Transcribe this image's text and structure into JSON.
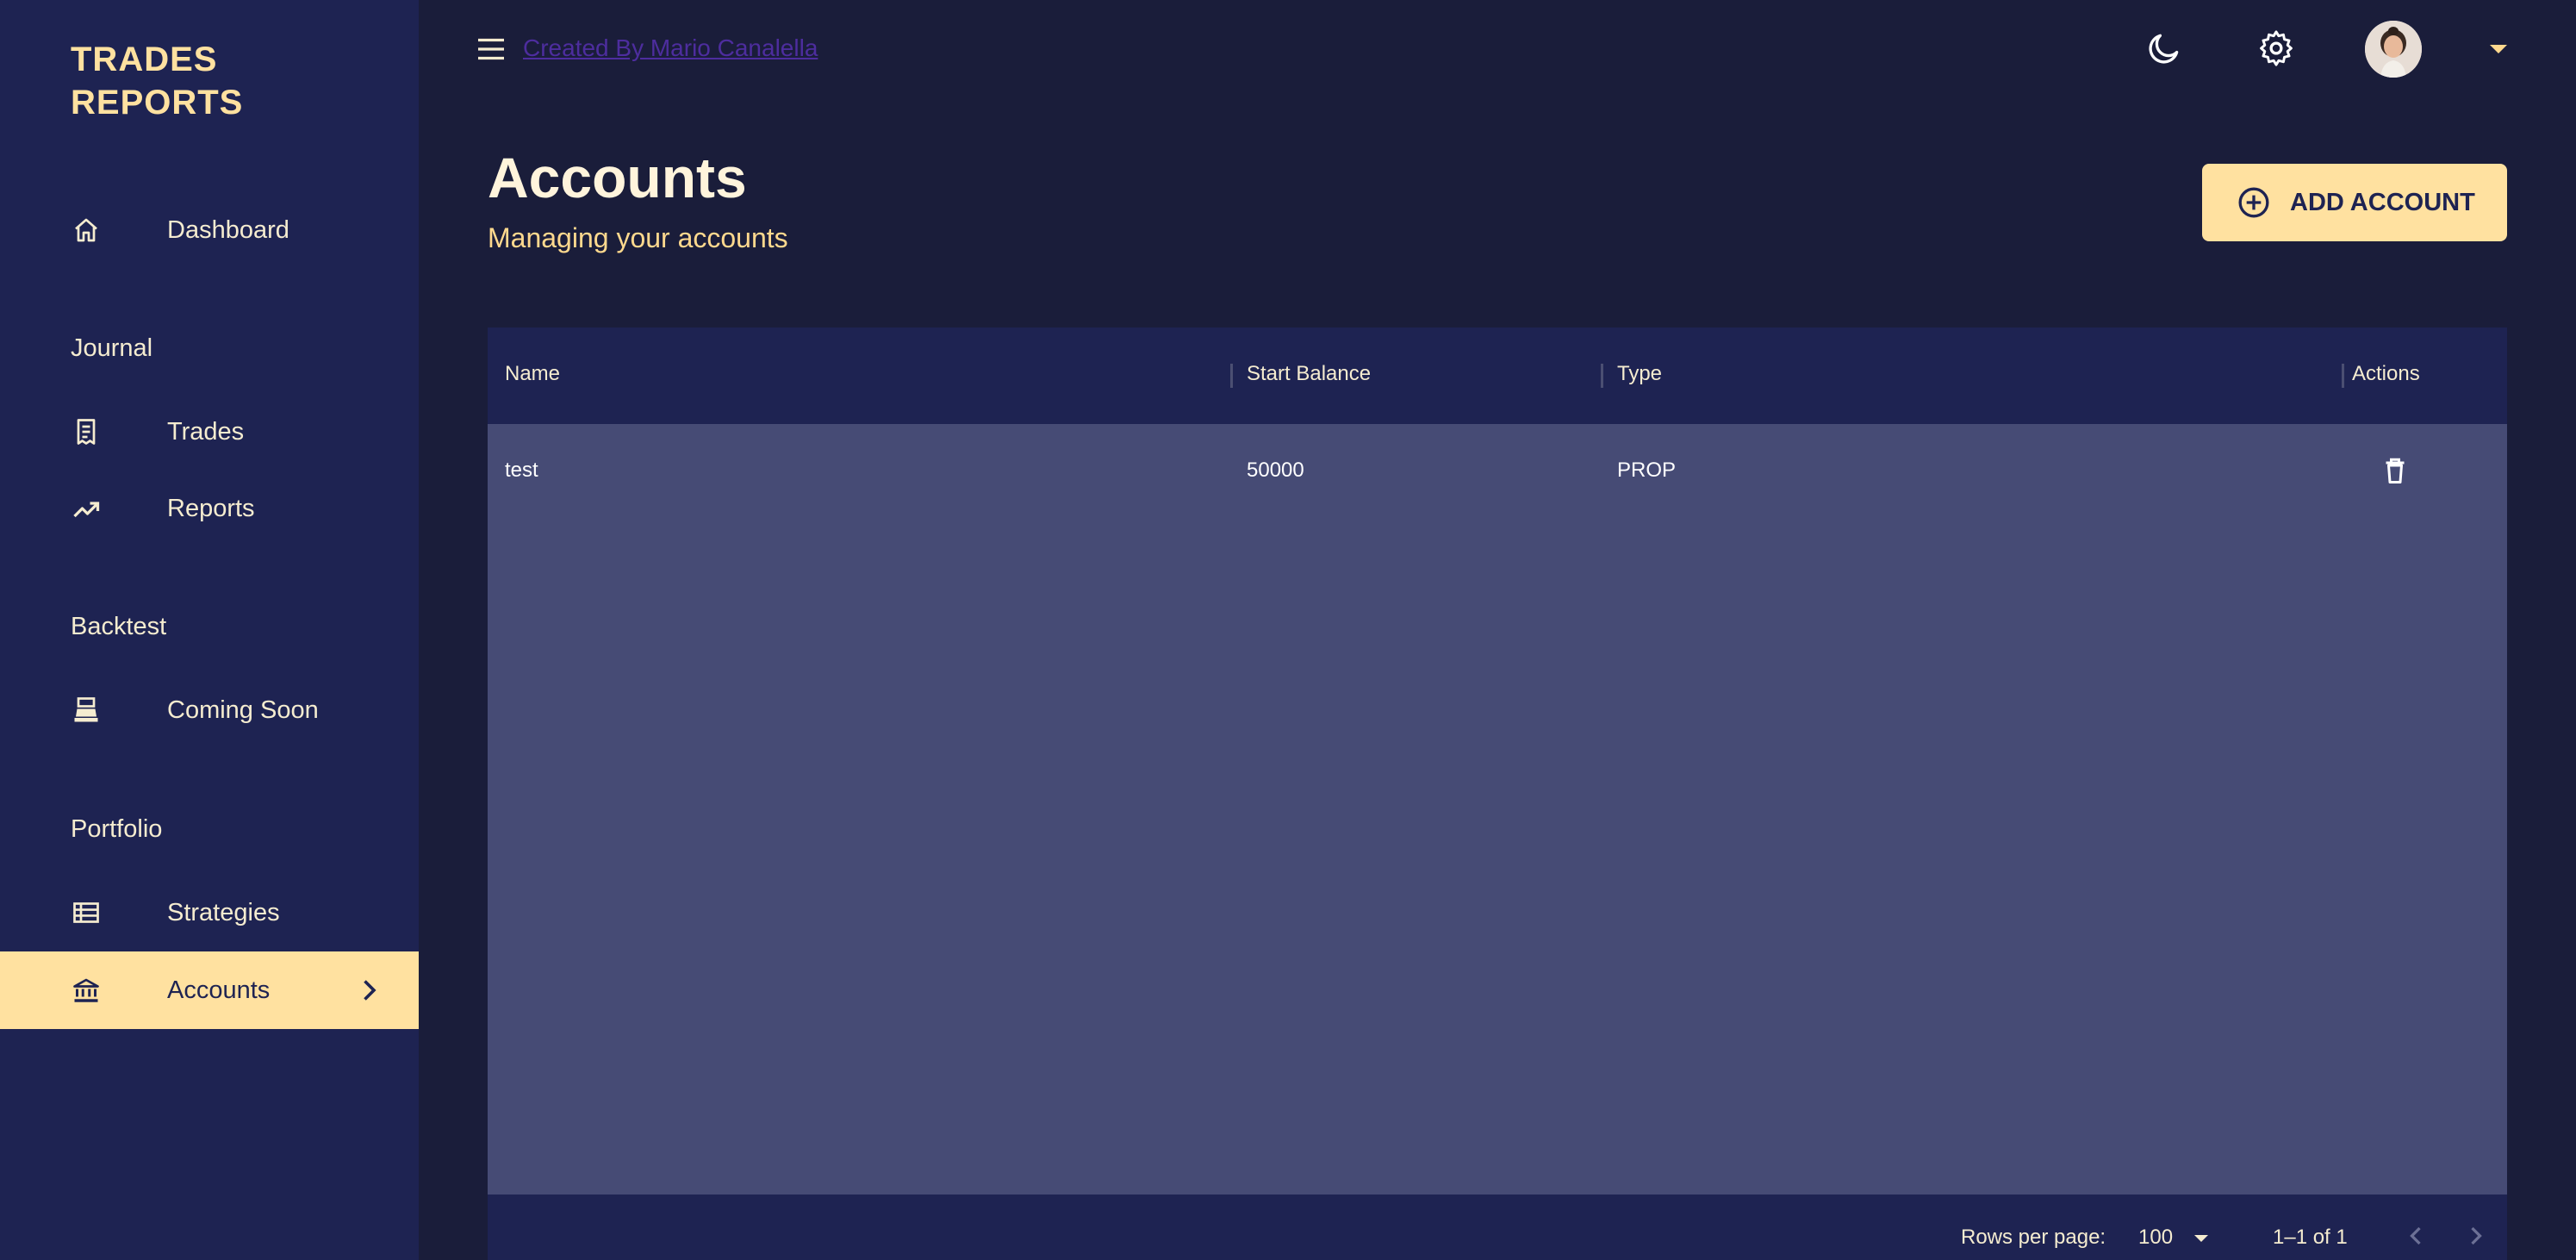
{
  "sidebar": {
    "brand_line1": "TRADES",
    "brand_line2": "REPORTS",
    "dashboard": "Dashboard",
    "section_journal": "Journal",
    "trades": "Trades",
    "reports": "Reports",
    "section_backtest": "Backtest",
    "coming_soon": "Coming Soon",
    "section_portfolio": "Portfolio",
    "strategies": "Strategies",
    "accounts": "Accounts"
  },
  "topbar": {
    "credit": "Created By Mario Canalella"
  },
  "page": {
    "title": "Accounts",
    "subtitle": "Managing your accounts",
    "add_button": "ADD ACCOUNT"
  },
  "table": {
    "columns": [
      "Name",
      "Start Balance",
      "Type",
      "Actions"
    ],
    "rows": [
      {
        "name": "test",
        "start_balance": "50000",
        "type": "PROP"
      }
    ],
    "footer": {
      "rows_per_page_label": "Rows per page:",
      "rows_per_page_value": "100",
      "range": "1–1 of 1"
    }
  },
  "colors": {
    "sidebar_bg": "#1e2352",
    "page_bg": "#1a1d3a",
    "accent": "#ffe1a0",
    "table_body": "#464b75"
  },
  "icons": {
    "dashboard": "home-icon",
    "trades": "receipt-icon",
    "reports": "trending-up-icon",
    "coming_soon": "cash-register-icon",
    "strategies": "list-table-icon",
    "accounts": "bank-icon",
    "theme": "moon-icon",
    "settings": "gear-icon",
    "add": "plus-circle-icon",
    "delete": "trash-icon"
  }
}
